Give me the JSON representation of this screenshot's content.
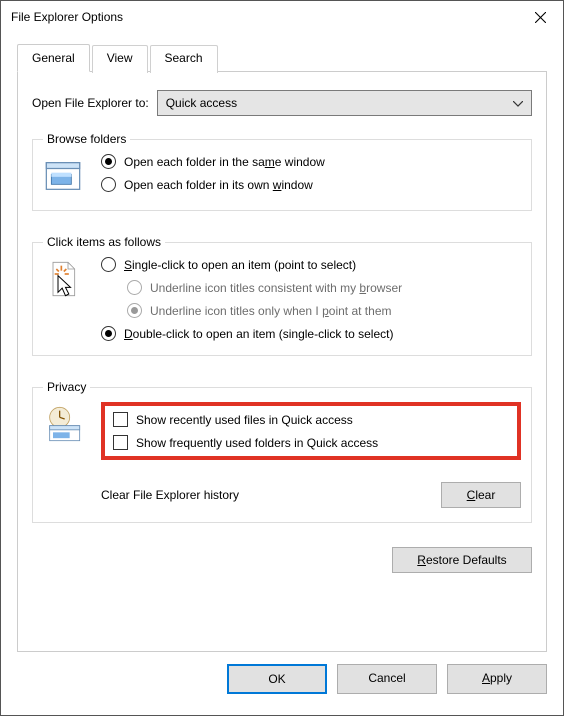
{
  "window": {
    "title": "File Explorer Options"
  },
  "tabs": {
    "general": "General",
    "view": "View",
    "search": "Search"
  },
  "open_to": {
    "label": "Open File Explorer to:",
    "value": "Quick access"
  },
  "browse": {
    "legend": "Browse folders",
    "same": "Open each folder in the sa",
    "same_u": "m",
    "same2": "e window",
    "own": "Open each folder in its own ",
    "own_u": "w",
    "own2": "indow"
  },
  "click": {
    "legend": "Click items as follows",
    "single_u": "S",
    "single": "ingle-click to open an item (point to select)",
    "u1a": "Underline icon titles consistent with my ",
    "u1b": "b",
    "u1c": "rowser",
    "u2a": "Underline icon titles only when I ",
    "u2b": "p",
    "u2c": "oint at them",
    "double_u": "D",
    "double": "ouble-click to open an item (single-click to select)"
  },
  "privacy": {
    "legend": "Privacy",
    "recent": "Show recently used files in Quick access",
    "frequent": "Show frequently used folders in Quick access",
    "clear_label": "Clear File Explorer history",
    "clear_btn_u": "C",
    "clear_btn": "lear"
  },
  "restore": {
    "u": "R",
    "rest": "estore Defaults"
  },
  "buttons": {
    "ok": "OK",
    "cancel": "Cancel",
    "apply_u": "A",
    "apply": "pply"
  }
}
